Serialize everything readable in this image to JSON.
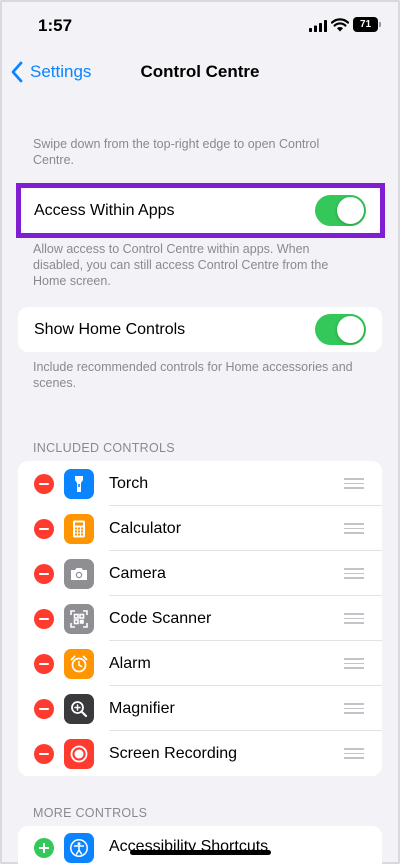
{
  "status_bar": {
    "time": "1:57",
    "battery": "71",
    "signal_icon": "signal-bars-icon",
    "wifi_icon": "wifi-icon"
  },
  "nav": {
    "back_label": "Settings",
    "back_icon": "chevron-left-icon",
    "title": "Control Centre",
    "accent_color": "#0a84ff"
  },
  "intro_text": "Swipe down from the top-right edge to open Control Centre.",
  "access_within_apps": {
    "label": "Access Within Apps",
    "enabled": true,
    "footer": "Allow access to Control Centre within apps. When disabled, you can still access Control Centre from the Home screen."
  },
  "show_home_controls": {
    "label": "Show Home Controls",
    "enabled": true,
    "footer": "Include recommended controls for Home accessories and scenes."
  },
  "toggle_on_color": "#34c759",
  "highlight_color": "#7f1fd1",
  "included_controls": {
    "header": "INCLUDED CONTROLS",
    "items": [
      {
        "label": "Torch",
        "icon": "torch-icon",
        "color": "#0a84ff"
      },
      {
        "label": "Calculator",
        "icon": "calculator-icon",
        "color": "#ff9500"
      },
      {
        "label": "Camera",
        "icon": "camera-icon",
        "color": "#8e8e93"
      },
      {
        "label": "Code Scanner",
        "icon": "qr-code-icon",
        "color": "#8e8e93"
      },
      {
        "label": "Alarm",
        "icon": "alarm-clock-icon",
        "color": "#ff9500"
      },
      {
        "label": "Magnifier",
        "icon": "magnifier-icon",
        "color": "#3a3a3c"
      },
      {
        "label": "Screen Recording",
        "icon": "screen-recording-icon",
        "color": "#ff3b30"
      }
    ]
  },
  "more_controls": {
    "header": "MORE CONTROLS",
    "items": [
      {
        "label": "Accessibility Shortcuts",
        "icon": "accessibility-icon",
        "color": "#0a84ff"
      }
    ]
  }
}
